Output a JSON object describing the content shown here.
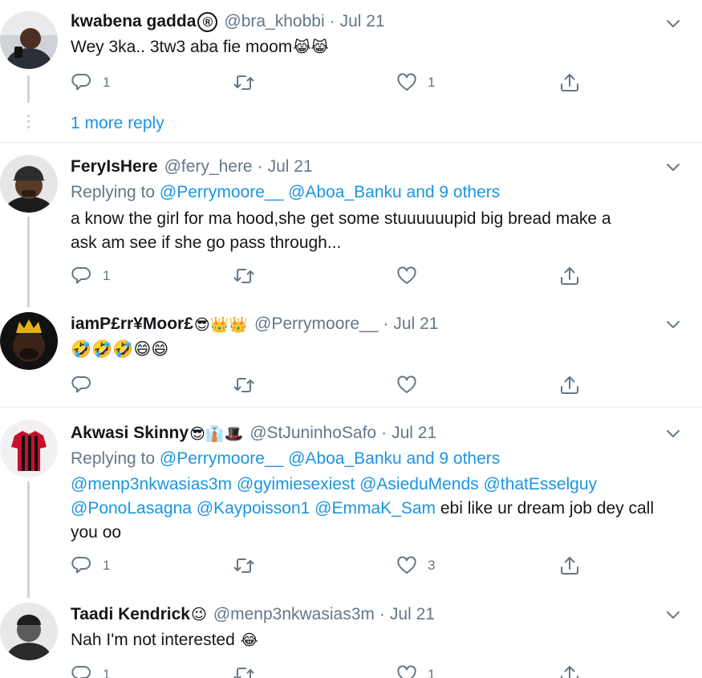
{
  "tweets": [
    {
      "name": "kwabena gadda",
      "name_badge": "®",
      "handle": "@bra_khobbi",
      "date": "Jul 21",
      "text": "Wey 3ka.. 3tw3 aba fie moom",
      "text_emoji": "😹😹",
      "replies": "1",
      "retweets": "",
      "likes": "1",
      "more_reply": "1 more reply"
    },
    {
      "name": "FeryIsHere",
      "handle": "@fery_here",
      "date": "Jul 21",
      "replying_prefix": "Replying to",
      "replying_users": "@Perrymoore__ @Aboa_Banku and 9 others",
      "text_line1": "a know the girl for ma hood,she get some stuuuuuupid big bread make a",
      "text_line2": "ask am see if she go pass through...",
      "replies": "1",
      "retweets": "",
      "likes": ""
    },
    {
      "name": "iamP£rr¥Moor£",
      "name_emoji": "😎👑👑",
      "handle": "@Perrymoore__",
      "date": "Jul 21",
      "text_emoji": "🤣🤣🤣😄😄",
      "replies": "",
      "retweets": "",
      "likes": ""
    },
    {
      "name": "Akwasi Skinny",
      "name_emoji": "😎👔🎩",
      "handle": "@StJuninhoSafo",
      "date": "Jul 21",
      "replying_prefix": "Replying to",
      "replying_users": "@Perrymoore__ @Aboa_Banku and 9 others",
      "mentions_line1": "@menp3nkwasias3m @gyimiesexiest @AsieduMends @thatEsselguy",
      "mentions_line2": "@PonoLasagna @Kaypoisson1 @EmmaK_Sam",
      "text_tail": " ebi like ur dream job dey call",
      "text_line3": "you oo",
      "replies": "1",
      "retweets": "",
      "likes": "3"
    },
    {
      "name": "Taadi Kendrick",
      "name_emoji": "😉",
      "handle": "@menp3nkwasias3m",
      "date": "Jul 21",
      "text": "Nah I'm not interested",
      "text_emoji": "😂",
      "replies": "1",
      "retweets": "",
      "likes": "1"
    }
  ],
  "separator": "·",
  "icons": {
    "reply": "reply-icon",
    "retweet": "retweet-icon",
    "like": "heart-icon",
    "share": "share-icon",
    "menu": "chevron-down-icon"
  },
  "colors": {
    "link": "#1b95e0",
    "muted": "#657786",
    "text": "#14171a",
    "thread_line": "#ccd6dd",
    "separator": "#e6ecf0"
  }
}
